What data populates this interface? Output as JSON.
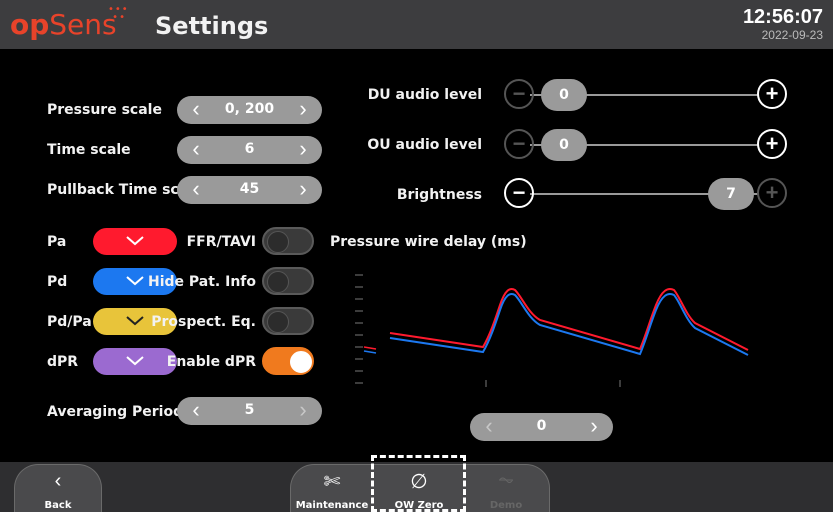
{
  "header": {
    "logo_op": "op",
    "logo_sens": "Sens",
    "title": "Settings",
    "time": "12:56:07",
    "date": "2022-09-23"
  },
  "left_settings": {
    "pressure_scale": {
      "label": "Pressure scale",
      "value": "0, 200"
    },
    "time_scale": {
      "label": "Time scale",
      "value": "6"
    },
    "pullback_time_scale": {
      "label": "Pullback Time scale",
      "value": "45"
    },
    "averaging_period": {
      "label": "Averaging Period",
      "value": "5"
    }
  },
  "colors": [
    {
      "label": "Pa",
      "color": "#ff1a2e"
    },
    {
      "label": "Pd",
      "color": "#1c78f0"
    },
    {
      "label": "Pd/Pa",
      "color": "#e8c43a"
    },
    {
      "label": "dPR",
      "color": "#9b6ad0"
    }
  ],
  "toggles": [
    {
      "label": "FFR/TAVI",
      "on": false
    },
    {
      "label": "Hide Pat. Info",
      "on": false
    },
    {
      "label": "Prospect. Eq.",
      "on": false
    },
    {
      "label": "Enable dPR",
      "on": true
    }
  ],
  "audio": {
    "du_label": "DU audio level",
    "du_value": "0",
    "ou_label": "OU audio level",
    "ou_value": "0",
    "brightness_label": "Brightness",
    "brightness_value": "7"
  },
  "wire_delay": {
    "label": "Pressure wire delay (ms)",
    "value": "0"
  },
  "footer": {
    "back": "Back",
    "maintenance": "Maintenance",
    "ow_zero": "OW Zero",
    "demo": "Demo"
  }
}
